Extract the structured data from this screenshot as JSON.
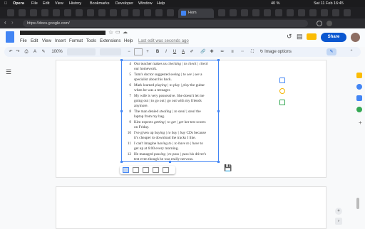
{
  "menubar": {
    "app": "Opera",
    "items": [
      "File",
      "Edit",
      "View",
      "History",
      "Bookmarks",
      "Developer",
      "Window",
      "Help"
    ],
    "battery": "40 %",
    "date": "Sat 11 Feb 16:45"
  },
  "tab": {
    "title": "Hom"
  },
  "address": {
    "url": "https://docs.google.com/"
  },
  "doc": {
    "menus": [
      "File",
      "Edit",
      "View",
      "Insert",
      "Format",
      "Tools",
      "Extensions",
      "Help"
    ],
    "last_edit": "Last edit was seconds ago",
    "share_label": "Share"
  },
  "toolbar": {
    "zoom": "100%",
    "image_options": "Image options"
  },
  "content": {
    "rows": [
      {
        "n": "4",
        "a": "Our teacher makes us ",
        "b": "checking | to check | check",
        "c": "",
        "w": "our homework."
      },
      {
        "n": "5",
        "a": "Tom's doctor suggested ",
        "b": "seeing | to see | see",
        "c": " a",
        "w": "specialist about his back."
      },
      {
        "n": "6",
        "a": "Mark learned ",
        "b": "playing | to play | play",
        "c": " the guitar",
        "w": "when he was a teenager."
      },
      {
        "n": "7",
        "a": "My wife is very possessive. She doesn't let me",
        "b": "",
        "c": "",
        "w": "going out | to go out | go out with my friends anymore."
      },
      {
        "n": "8",
        "a": "The man denied ",
        "b": "stealing | to steal | steal",
        "c": " the",
        "w": "laptop from my bag."
      },
      {
        "n": "9",
        "a": "Kim expects ",
        "b": "getting | to get | get",
        "c": " her test scores",
        "w": "on Friday."
      },
      {
        "n": "10",
        "a": "I've given up ",
        "b": "buying | to buy | buy",
        "c": " CDs because",
        "w": "it's cheaper to download the tracks I like."
      },
      {
        "n": "11",
        "a": "I can't imagine ",
        "b": "having to | to have to | have to",
        "c": "",
        "w": "get up at 6:00 every morning."
      },
      {
        "n": "12",
        "a": "He managed ",
        "b": "passing | to pass | pass",
        "c": " his driver's",
        "w": "test even though he was really nervous."
      }
    ]
  },
  "colors": {
    "share": "#0b57d0",
    "selection": "#4285f4",
    "menubar": "#1b1b1d"
  }
}
